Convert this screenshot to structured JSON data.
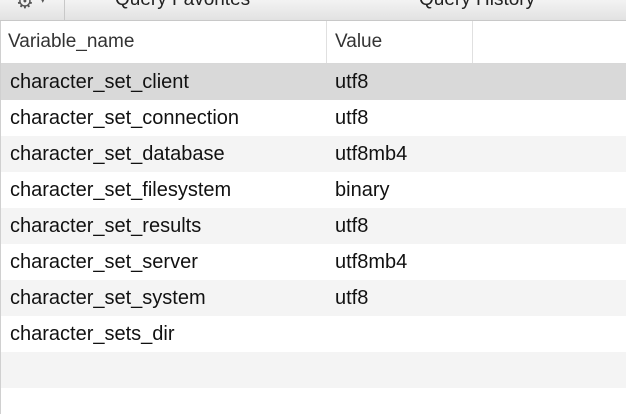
{
  "toolbar": {
    "gear_icon": "⚙",
    "caret_icon": "▾",
    "tabs": [
      {
        "label": "Query Favorites"
      },
      {
        "label": "Query History"
      }
    ]
  },
  "table": {
    "columns": [
      "Variable_name",
      "Value"
    ],
    "rows": [
      {
        "name": "character_set_client",
        "value": "utf8",
        "selected": true
      },
      {
        "name": "character_set_connection",
        "value": "utf8"
      },
      {
        "name": "character_set_database",
        "value": "utf8mb4"
      },
      {
        "name": "character_set_filesystem",
        "value": "binary"
      },
      {
        "name": "character_set_results",
        "value": "utf8"
      },
      {
        "name": "character_set_server",
        "value": "utf8mb4"
      },
      {
        "name": "character_set_system",
        "value": "utf8"
      },
      {
        "name": "character_sets_dir",
        "value": ""
      }
    ]
  }
}
